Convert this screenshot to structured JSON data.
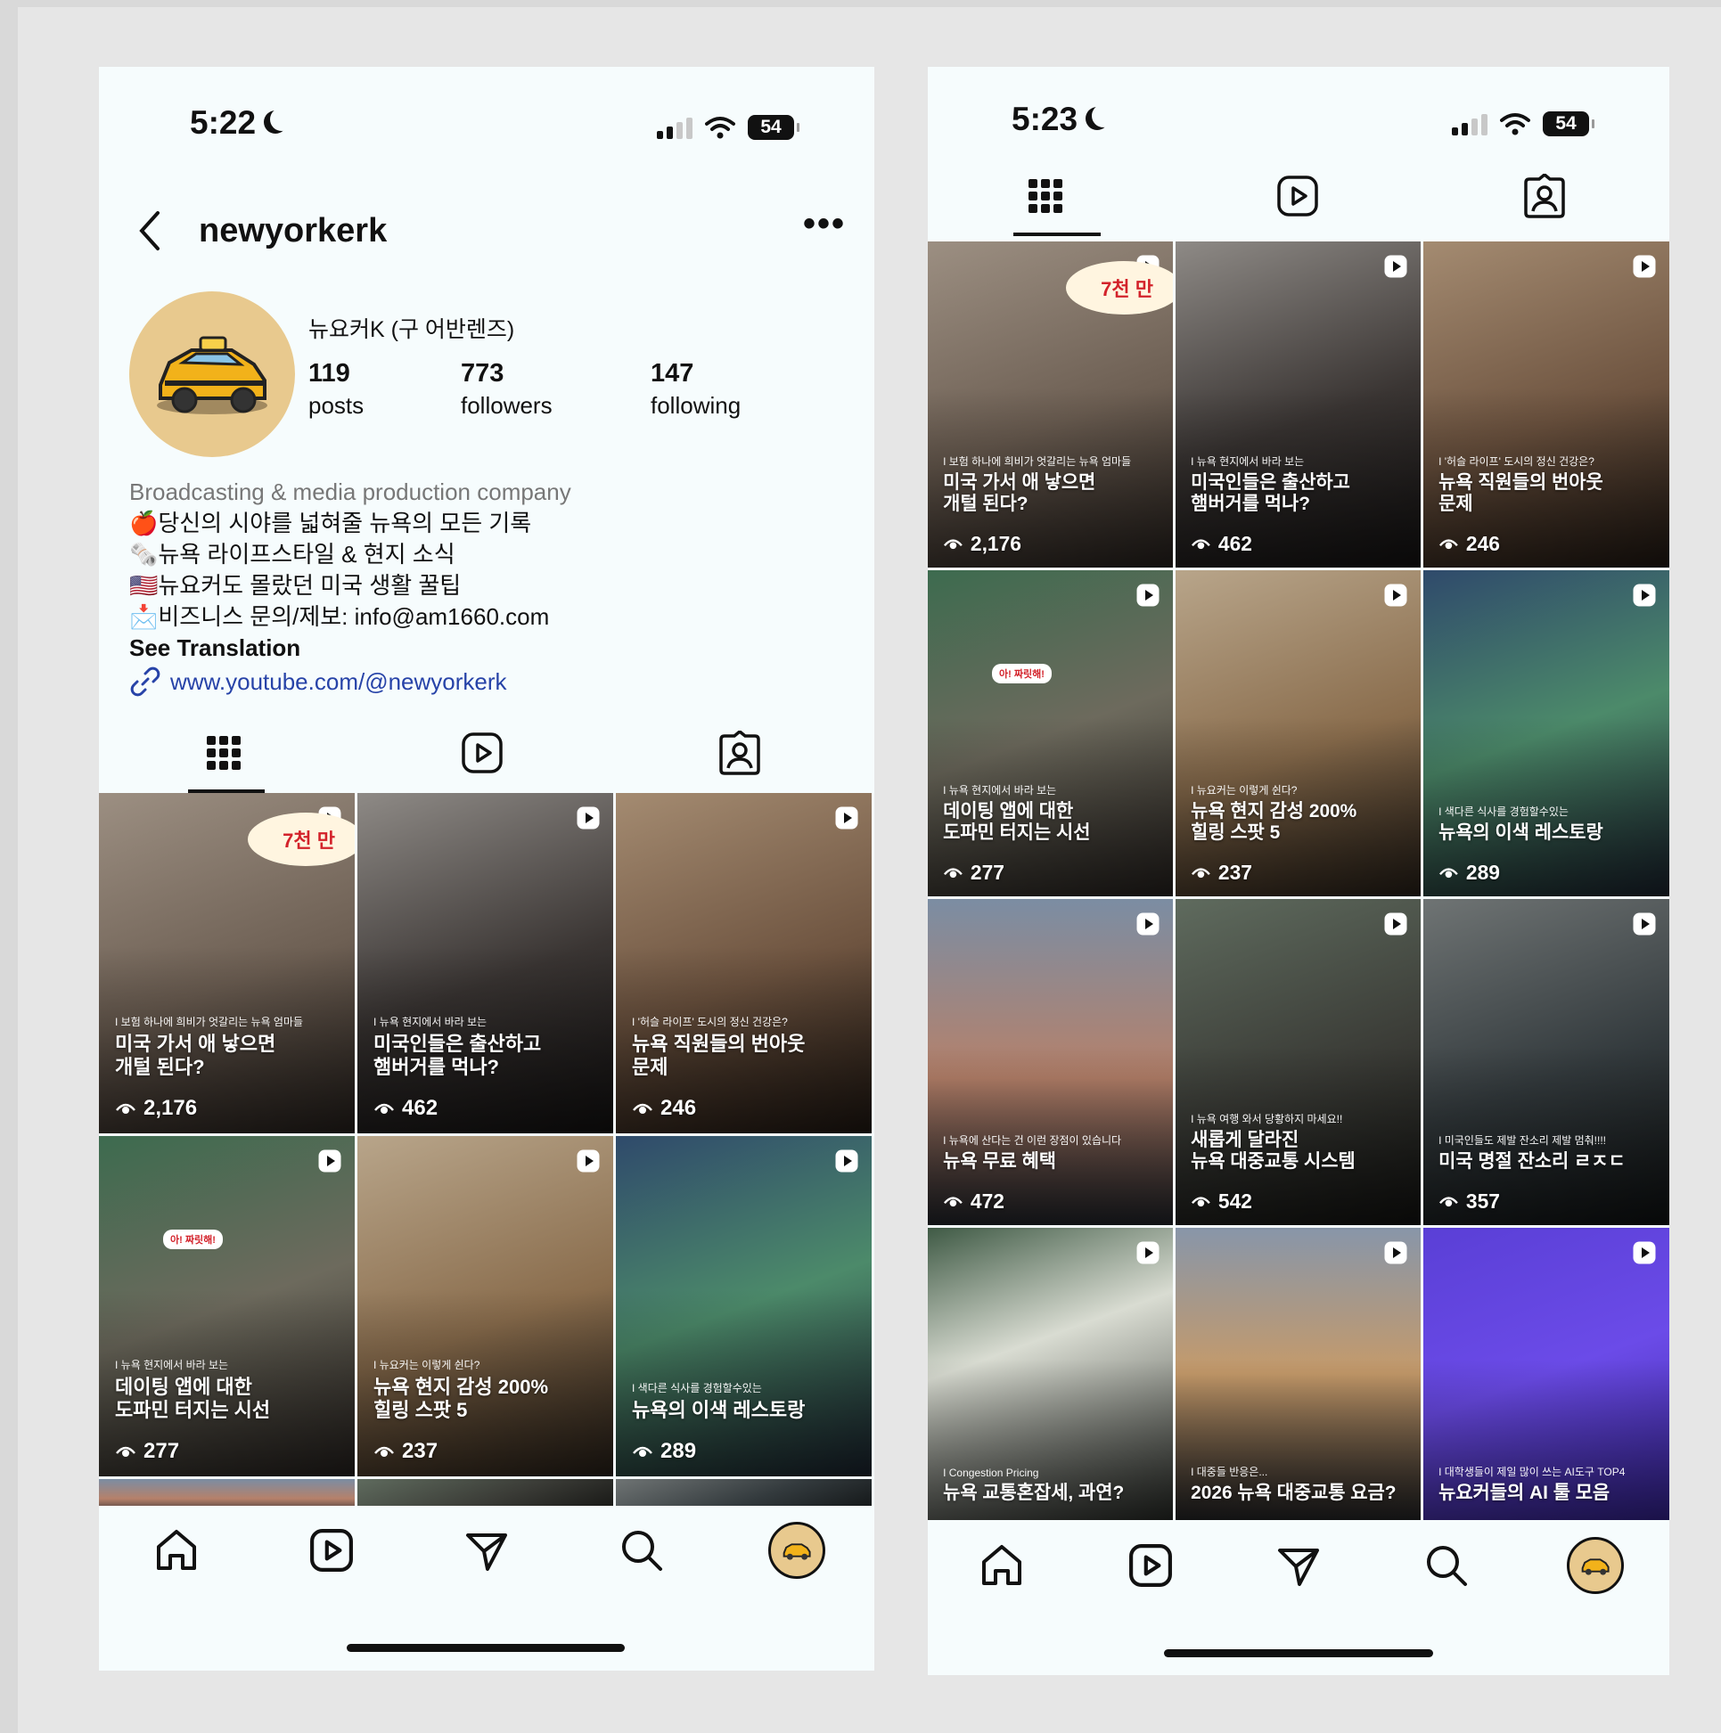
{
  "left": {
    "status": {
      "time": "5:22",
      "battery": "54"
    },
    "header": {
      "username": "newyorkerk"
    },
    "profile": {
      "display_name": "뉴요커K (구 어반렌즈)",
      "stats": [
        {
          "value": "119",
          "label": "posts"
        },
        {
          "value": "773",
          "label": "followers"
        },
        {
          "value": "147",
          "label": "following"
        }
      ],
      "category": "Broadcasting & media production company",
      "bio": [
        "🍎당신의 시야를 넓혀줄 뉴욕의 모든 기록",
        "🗞️뉴욕 라이프스타일 & 현지 소식",
        "🇺🇸뉴요커도 몰랐던 미국 생활 꿀팁",
        "📩비즈니스 문의/제보: info@am1660.com"
      ],
      "see_translation": "See Translation",
      "link": "www.youtube.com/@newyorkerk"
    }
  },
  "right": {
    "status": {
      "time": "5:23",
      "battery": "54"
    }
  },
  "posts": [
    {
      "sub": "I 보험 하나에 희비가 엇갈리는 뉴욕 엄마들",
      "title": "미국 가서 애 낳으면\n개털 된다?",
      "views": "2,176",
      "badge": "7천 만"
    },
    {
      "sub": "I 뉴욕 현지에서 바라 보는",
      "title": "미국인들은 출산하고\n햄버거를 먹나?",
      "views": "462"
    },
    {
      "sub": "I '허슬 라이프' 도시의 정신 건강은?",
      "title": "뉴욕 직원들의 번아웃\n문제",
      "views": "246"
    },
    {
      "sub": "I 뉴욕 현지에서 바라 보는",
      "title": "데이팅 앱에 대한\n도파민 터지는 시선",
      "views": "277",
      "badge2": "아! 짜릿해!"
    },
    {
      "sub": "I 뉴요커는 이렇게 쉰다?",
      "title": "뉴욕 현지 감성 200%\n힐링 스팟 5",
      "views": "237"
    },
    {
      "sub": "I 색다른 식사를 경험할수있는",
      "title": "뉴욕의 이색 레스토랑",
      "views": "289"
    },
    {
      "sub": "I 뉴욕에 산다는 건 이런 장점이 있습니다",
      "title": "뉴욕 무료 혜택",
      "views": "472"
    },
    {
      "sub": "I 뉴욕 여행 와서 당황하지 마세요!!",
      "title": "새롭게 달라진\n뉴욕 대중교통 시스템",
      "views": "542"
    },
    {
      "sub": "I 미국인들도 제발 잔소리 제발 멈춰!!!!",
      "title": "미국 명절 잔소리 ㄹㅈㄷ",
      "views": "357"
    },
    {
      "sub": "I Congestion Pricing",
      "title": "뉴욕 교통혼잡세, 과연?",
      "views": ""
    },
    {
      "sub": "I 대중들 반응은...",
      "title": "2026 뉴욕 대중교통 요금?",
      "views": ""
    },
    {
      "sub": "I 대학생들이 제일 많이 쓰는 AI도구 TOP4",
      "title": "뉴요커들의 AI 툴 모음",
      "views": ""
    }
  ],
  "icons": {
    "back": "chevron-left-icon",
    "more": "ellipsis-icon",
    "grid": "grid-icon",
    "reels": "reels-icon",
    "tagged": "tagged-icon",
    "home": "home-icon",
    "send": "send-icon",
    "search": "search-icon",
    "link": "link-icon",
    "views": "eye-icon"
  },
  "colors": {
    "link": "#2743a8",
    "background": "#f6fcfd",
    "badge_red": "#d3222a"
  }
}
